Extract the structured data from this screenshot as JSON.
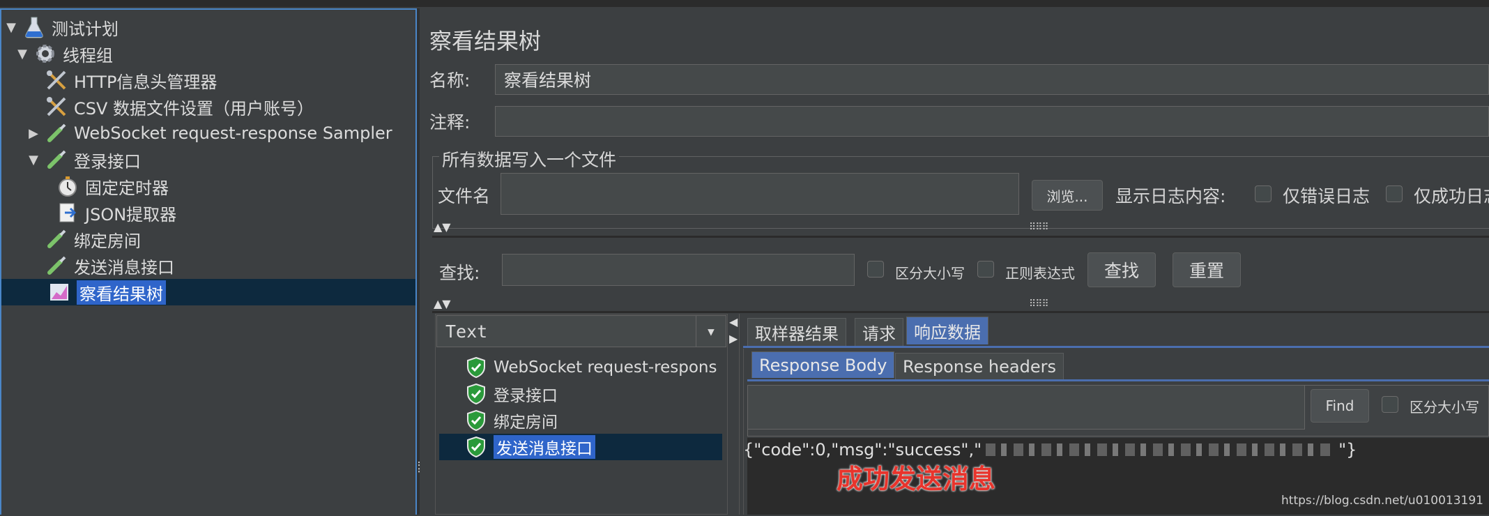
{
  "tree": {
    "items": [
      {
        "label": "测试计划",
        "icon": "flask-icon",
        "arrow": "▼"
      },
      {
        "label": "线程组",
        "icon": "gear-icon",
        "arrow": "▼"
      },
      {
        "label": "HTTP信息头管理器",
        "icon": "wrench-screwdriver-icon",
        "arrow": ""
      },
      {
        "label": "CSV 数据文件设置（用户账号）",
        "icon": "wrench-screwdriver-icon",
        "arrow": ""
      },
      {
        "label": "WebSocket request-response Sampler",
        "icon": "pipette-icon",
        "arrow": "▶"
      },
      {
        "label": "登录接口",
        "icon": "pipette-icon",
        "arrow": "▼"
      },
      {
        "label": "固定定时器",
        "icon": "stopwatch-icon",
        "arrow": ""
      },
      {
        "label": "JSON提取器",
        "icon": "document-arrow-icon",
        "arrow": ""
      },
      {
        "label": "绑定房间",
        "icon": "pipette-icon",
        "arrow": ""
      },
      {
        "label": "发送消息接口",
        "icon": "pipette-icon",
        "arrow": ""
      },
      {
        "label": "察看结果树",
        "icon": "chart-icon",
        "arrow": ""
      }
    ]
  },
  "main": {
    "title": "察看结果树",
    "name_label": "名称:",
    "name_value": "察看结果树",
    "comment_label": "注释:",
    "comment_value": "",
    "file_group_title": "所有数据写入一个文件",
    "file_label": "文件名",
    "file_value": "",
    "browse_label": "浏览...",
    "log_content_label": "显示日志内容:",
    "errors_only_label": "仅错误日志",
    "success_only_label": "仅成功日志"
  },
  "search": {
    "label": "查找:",
    "value": "",
    "case_label": "区分大小写",
    "regex_label": "正则表达式",
    "find_label": "查找",
    "reset_label": "重置"
  },
  "results": {
    "renderer": "Text",
    "items": [
      {
        "label": "WebSocket request-respons"
      },
      {
        "label": "登录接口"
      },
      {
        "label": "绑定房间"
      },
      {
        "label": "发送消息接口"
      }
    ],
    "tabs": [
      "取样器结果",
      "请求",
      "响应数据"
    ],
    "subtabs": [
      "Response Body",
      "Response headers"
    ],
    "find_label": "Find",
    "case_label": "区分大小写",
    "body_text": "{\"code\":0,\"msg\":\"success\",\"",
    "body_end": "\"}",
    "annotation": "成功发送消息"
  },
  "watermark": "https://blog.csdn.net/u010013191"
}
